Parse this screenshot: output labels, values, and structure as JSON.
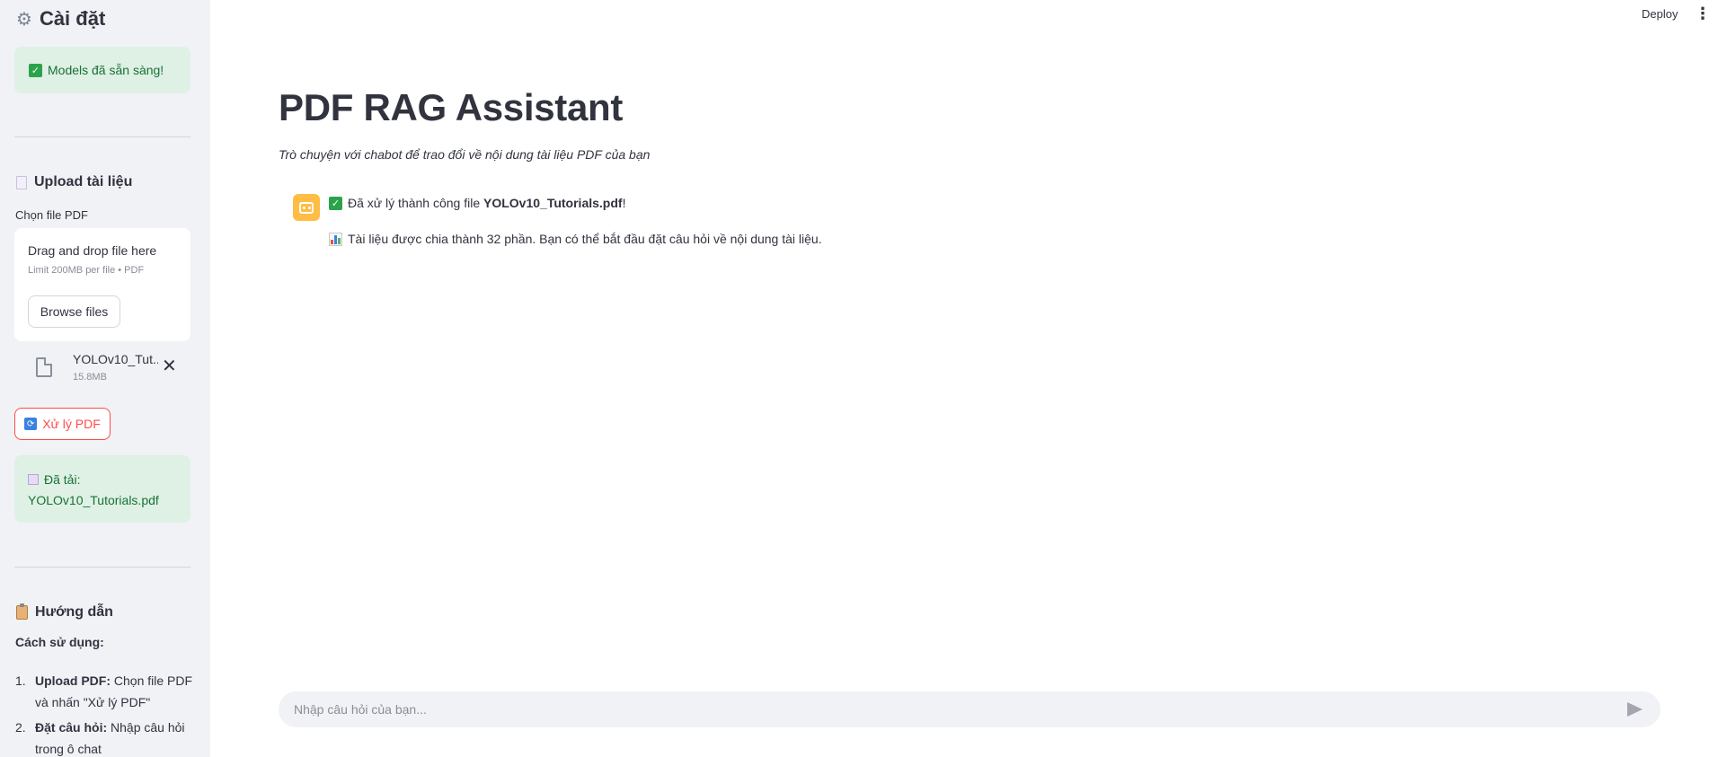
{
  "sidebar": {
    "title": "Cài đặt",
    "title_icon": "gear-icon",
    "models_ready": "Models đã sẵn sàng!",
    "upload_section": {
      "title": "Upload tài liệu",
      "icon": "document-icon"
    },
    "file_input_label": "Chọn file PDF",
    "dropzone": {
      "title": "Drag and drop file here",
      "limit": "Limit 200MB per file • PDF",
      "browse_label": "Browse files"
    },
    "uploaded_file": {
      "name": "YOLOv10_Tut...",
      "size": "15.8MB"
    },
    "process_button": "Xử lý PDF",
    "loaded_alert": {
      "prefix": "Đã tải:",
      "file": "YOLOv10_Tutorials.pdf"
    },
    "howto_section": {
      "title": "Hướng dẫn",
      "icon": "clipboard-icon",
      "usage_label": "Cách sử dụng:",
      "steps": [
        {
          "num": "1.",
          "bold": "Upload PDF:",
          "text": " Chọn file PDF và nhấn \"Xử lý PDF\""
        },
        {
          "num": "2.",
          "bold": "Đặt câu hỏi:",
          "text": " Nhập câu hỏi trong ô chat"
        }
      ]
    }
  },
  "header": {
    "deploy": "Deploy",
    "menu_icon": "kebab-menu-icon"
  },
  "main": {
    "title": "PDF RAG Assistant",
    "subtitle": "Trò chuyện với chabot để trao đổi về nội dung tài liệu PDF của bạn",
    "messages": {
      "success_prefix": "Đã xử lý thành công file ",
      "success_file": "YOLOv10_Tutorials.pdf",
      "success_suffix": "!",
      "info": "Tài liệu được chia thành 32 phần. Bạn có thể bắt đầu đặt câu hỏi về nội dung tài liệu."
    },
    "chat_input_placeholder": "Nhập câu hỏi của bạn..."
  },
  "colors": {
    "accent": "#ff4b4b",
    "success_bg": "#dff0e5",
    "success_text": "#177233",
    "sidebar_bg": "#f0f2f6",
    "avatar_bg": "#ffbd45"
  }
}
